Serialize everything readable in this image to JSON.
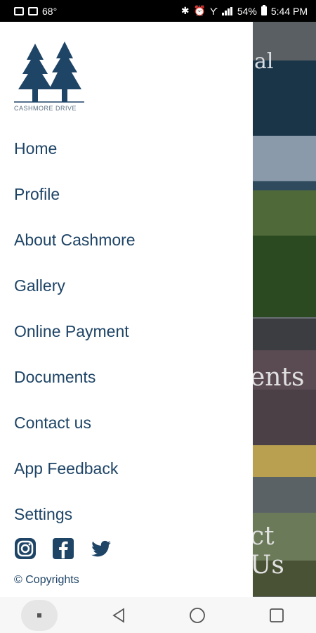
{
  "status_bar": {
    "temperature": "68°",
    "battery_percent": "54%",
    "time": "5:44 PM"
  },
  "drawer": {
    "logo_caption": "CASHMORE DRIVE",
    "menu": [
      {
        "label": "Home"
      },
      {
        "label": "Profile"
      },
      {
        "label": "About Cashmore"
      },
      {
        "label": "Gallery"
      },
      {
        "label": "Online Payment"
      },
      {
        "label": "Documents"
      },
      {
        "label": "Contact us"
      },
      {
        "label": "App Feedback"
      },
      {
        "label": "Settings"
      }
    ],
    "social": [
      "instagram-icon",
      "facebook-icon",
      "twitter-icon"
    ],
    "copyright": "© Copyrights"
  },
  "background": {
    "title_fragment": "al",
    "docs_fragment": "ents",
    "contact_fragment": "ct Us"
  },
  "colors": {
    "brand": "#1e4466",
    "header_dark": "#1a3448"
  }
}
